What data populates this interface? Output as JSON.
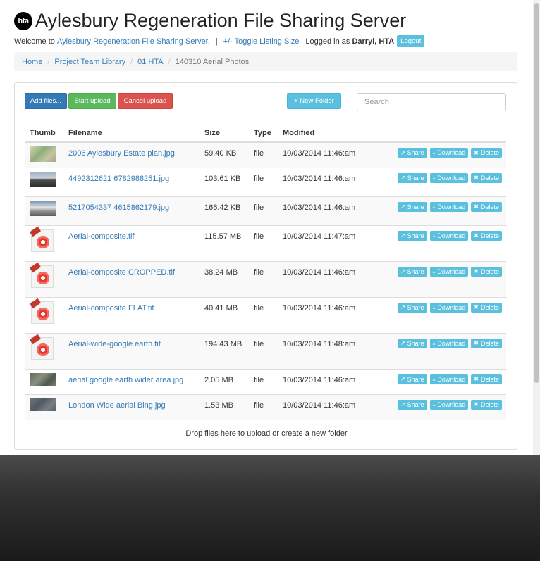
{
  "header": {
    "logo_text": "hta",
    "title": "Aylesbury Regeneration File Sharing Server"
  },
  "welcome": {
    "prefix": "Welcome to",
    "link": "Aylesbury Regeneration File Sharing Server.",
    "separator": "|",
    "toggle": "+/- Toggle Listing Size",
    "logged_in_as": "Logged in as",
    "user": "Darryl, HTA",
    "logout": "Logout"
  },
  "breadcrumb": {
    "items": [
      "Home",
      "Project Team Library",
      "01 HTA"
    ],
    "active": "140310 Aerial Photos",
    "divider": "/"
  },
  "toolbar": {
    "add_files": "Add files...",
    "start_upload": "Start upload",
    "cancel_upload": "Cancel upload",
    "new_folder": "+ New Folder",
    "search_placeholder": "Search"
  },
  "table": {
    "headers": [
      "Thumb",
      "Filename",
      "Size",
      "Type",
      "Modified"
    ],
    "actions": {
      "share": "Share",
      "download": "Download",
      "delete": "Delete"
    },
    "rows": [
      {
        "thumb": "plan-thumb",
        "filename": "2006 Aylesbury Estate plan.jpg",
        "size": "59.40 KB",
        "type": "file",
        "modified": "10/03/2014 11:46:am"
      },
      {
        "thumb": "street-thumb",
        "filename": "4492312621 6782988251.jpg",
        "size": "103.61 KB",
        "type": "file",
        "modified": "10/03/2014 11:46:am"
      },
      {
        "thumb": "building-thumb",
        "filename": "5217054337 4615862179.jpg",
        "size": "166.42 KB",
        "type": "file",
        "modified": "10/03/2014 11:46:am"
      },
      {
        "thumb": "tif-icon",
        "filename": "Aerial-composite.tif",
        "size": "115.57 MB",
        "type": "file",
        "modified": "10/03/2014 11:47:am"
      },
      {
        "thumb": "tif-icon",
        "filename": "Aerial-composite CROPPED.tif",
        "size": "38.24 MB",
        "type": "file",
        "modified": "10/03/2014 11:46:am"
      },
      {
        "thumb": "tif-icon",
        "filename": "Aerial-composite FLAT.tif",
        "size": "40.41 MB",
        "type": "file",
        "modified": "10/03/2014 11:46:am"
      },
      {
        "thumb": "tif-icon",
        "filename": "Aerial-wide-google earth.tif",
        "size": "194.43 MB",
        "type": "file",
        "modified": "10/03/2014 11:48:am"
      },
      {
        "thumb": "aerial-thumb",
        "filename": "aerial google earth wider area.jpg",
        "size": "2.05 MB",
        "type": "file",
        "modified": "10/03/2014 11:46:am"
      },
      {
        "thumb": "aerial-thumb",
        "filename": "London Wide aerial Bing.jpg",
        "size": "1.53 MB",
        "type": "file",
        "modified": "10/03/2014 11:46:am"
      }
    ]
  },
  "drop_message": "Drop files here to upload or create a new folder",
  "colors": {
    "primary": "#337ab7",
    "success": "#5cb85c",
    "danger": "#d9534f",
    "info": "#5bc0de"
  }
}
